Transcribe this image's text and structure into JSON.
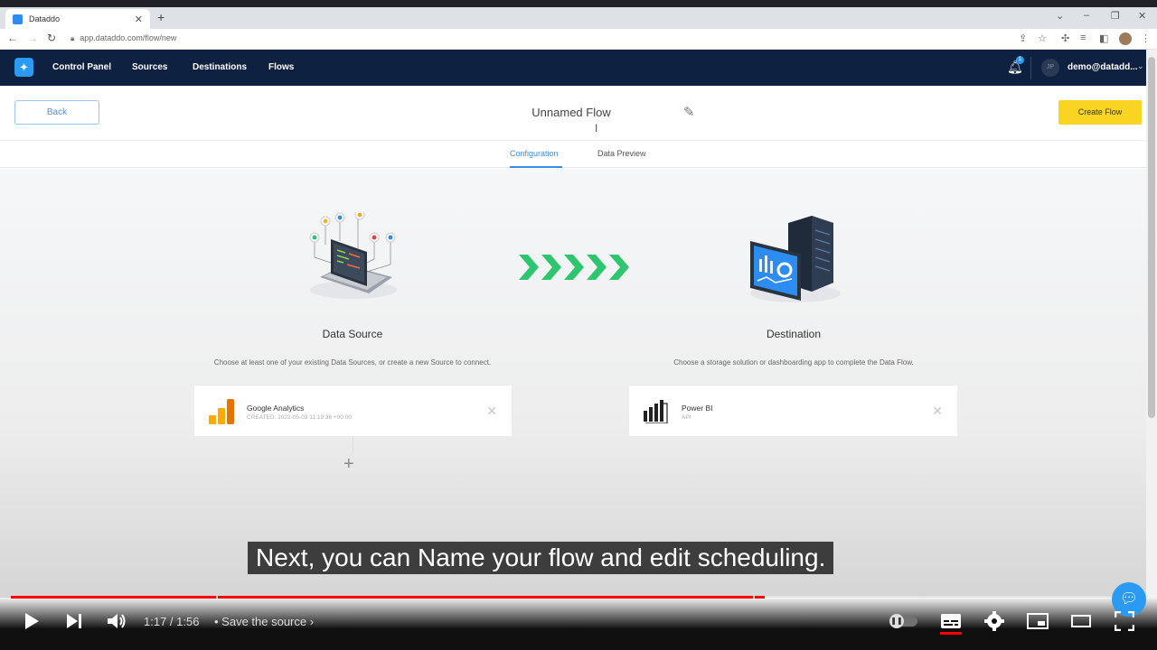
{
  "browser": {
    "tab_title": "Dataddo",
    "tab_close": "✕",
    "new_tab": "+",
    "url": "app.dataddo.com/flow/new"
  },
  "navbar": {
    "items": [
      "Control Panel",
      "Sources",
      "Destinations",
      "Flows"
    ],
    "notification_count": "1",
    "avatar_initials": "JP",
    "user": "demo@datadd..."
  },
  "header": {
    "back_label": "Back",
    "flow_name": "Unnamed Flow",
    "create_label": "Create Flow"
  },
  "tabs": {
    "configuration": "Configuration",
    "data_preview": "Data Preview"
  },
  "source": {
    "title": "Data Source",
    "description": "Choose at least one of your existing Data Sources, or create a new Source to connect.",
    "card_name": "Google Analytics",
    "card_sub": "CREATED: 2022-05-03 11:19:36 +00:00"
  },
  "destination": {
    "title": "Destination",
    "description": "Choose a storage solution or dashboarding app to complete the Data Flow.",
    "card_name": "Power BI",
    "card_sub": "API"
  },
  "subtitle": "Next, you can Name your flow and edit scheduling.",
  "player": {
    "time": "1:17 / 1:56",
    "chapter": "• Save the source",
    "progress_percent": 66.4,
    "chapter_marks_percent": [
      18.1,
      65.4
    ]
  },
  "colors": {
    "navbar": "#0f2140",
    "accent_blue": "#3a8ee6",
    "create_button": "#f9d423",
    "arrow_green": "#2dc56e",
    "progress_red": "#ff0000"
  }
}
